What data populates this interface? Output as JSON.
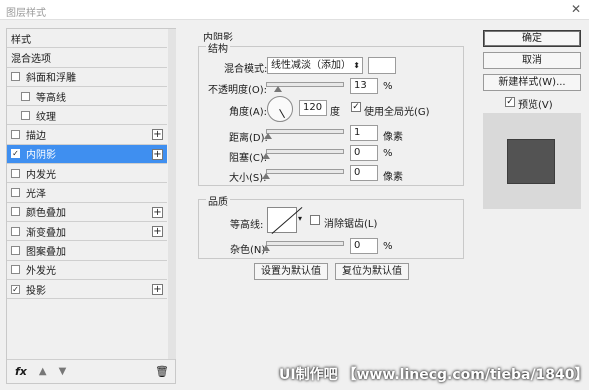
{
  "window": {
    "title": "图层样式",
    "close_icon": "close-icon"
  },
  "left": {
    "items": [
      {
        "label": "样式",
        "checkbox": false,
        "checked": false,
        "plus": false,
        "sub": false,
        "active": false
      },
      {
        "label": "混合选项",
        "checkbox": false,
        "checked": false,
        "plus": false,
        "sub": false,
        "active": false
      },
      {
        "label": "斜面和浮雕",
        "checkbox": true,
        "checked": false,
        "plus": false,
        "sub": false,
        "active": false
      },
      {
        "label": "等高线",
        "checkbox": true,
        "checked": false,
        "plus": false,
        "sub": true,
        "active": false
      },
      {
        "label": "纹理",
        "checkbox": true,
        "checked": false,
        "plus": false,
        "sub": true,
        "active": false
      },
      {
        "label": "描边",
        "checkbox": true,
        "checked": false,
        "plus": true,
        "sub": false,
        "active": false
      },
      {
        "label": "内阴影",
        "checkbox": true,
        "checked": true,
        "plus": true,
        "sub": false,
        "active": true
      },
      {
        "label": "内发光",
        "checkbox": true,
        "checked": false,
        "plus": false,
        "sub": false,
        "active": false
      },
      {
        "label": "光泽",
        "checkbox": true,
        "checked": false,
        "plus": false,
        "sub": false,
        "active": false
      },
      {
        "label": "颜色叠加",
        "checkbox": true,
        "checked": false,
        "plus": true,
        "sub": false,
        "active": false
      },
      {
        "label": "渐变叠加",
        "checkbox": true,
        "checked": false,
        "plus": true,
        "sub": false,
        "active": false
      },
      {
        "label": "图案叠加",
        "checkbox": true,
        "checked": false,
        "plus": false,
        "sub": false,
        "active": false
      },
      {
        "label": "外发光",
        "checkbox": true,
        "checked": false,
        "plus": false,
        "sub": false,
        "active": false
      },
      {
        "label": "投影",
        "checkbox": true,
        "checked": true,
        "plus": true,
        "sub": false,
        "active": false
      }
    ],
    "footer": {
      "fx": "fx",
      "up_icon": "arrow-up-icon",
      "down_icon": "arrow-down-icon",
      "trash_icon": "trash-icon"
    }
  },
  "inner_shadow": {
    "section_title": "内阴影",
    "structure": {
      "title": "结构",
      "blend_mode_label": "混合模式:",
      "blend_mode_value": "线性减淡（添加）",
      "opacity_label": "不透明度(O):",
      "opacity_value": "13",
      "opacity_unit": "%",
      "angle_label": "角度(A):",
      "angle_value": "120",
      "angle_unit": "度",
      "global_light_label": "使用全局光(G)",
      "global_light_checked": true,
      "distance_label": "距离(D):",
      "distance_value": "1",
      "distance_unit": "像素",
      "choke_label": "阻塞(C):",
      "choke_value": "0",
      "choke_unit": "%",
      "size_label": "大小(S):",
      "size_value": "0",
      "size_unit": "像素"
    },
    "quality": {
      "title": "品质",
      "contour_label": "等高线:",
      "antialias_label": "消除锯齿(L)",
      "antialias_checked": false,
      "noise_label": "杂色(N):",
      "noise_value": "0",
      "noise_unit": "%"
    },
    "set_default_label": "设置为默认值",
    "reset_default_label": "复位为默认值"
  },
  "right": {
    "ok_label": "确定",
    "cancel_label": "取消",
    "new_style_label": "新建样式(W)...",
    "preview_label": "预览(V)",
    "preview_checked": true
  },
  "watermark": "UI制作吧 【www.linecg.com/tieba/1840】"
}
